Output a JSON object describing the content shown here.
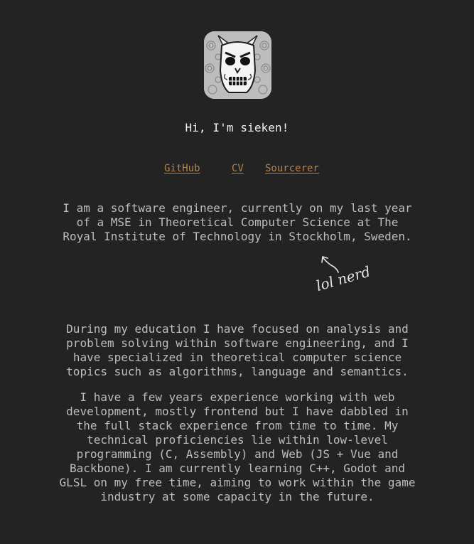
{
  "profile": {
    "avatar_icon": "demon-mask-avatar-icon",
    "greeting": "Hi, I'm sieken!"
  },
  "links": [
    {
      "label": "GitHub"
    },
    {
      "label": "CV"
    },
    {
      "label": "Sourcerer"
    }
  ],
  "about": {
    "intro": "I am a software engineer, currently on my last year of a MSE in Theoretical Computer Science at The Royal Institute of Technology in Stockholm, Sweden.",
    "annotation": "lol nerd",
    "education": "During my education I have focused on analysis and problem solving within software engineering, and I have specialized in theoretical computer science topics such as algorithms, language and semantics.",
    "experience": "I have a few years experience working with web development, mostly frontend but I have dabbled in the full stack experience from time to time. My technical proficiencies lie within low-level programming (C, Assembly) and Web (JS + Vue and Backbone). I am currently learning C++, Godot and GLSL on my free time, aiming to work within the game industry at some capacity in the future."
  },
  "colors": {
    "background": "#232323",
    "link": "#b8814a",
    "text": "#bdbdbd",
    "heading": "#f0f0f0"
  }
}
